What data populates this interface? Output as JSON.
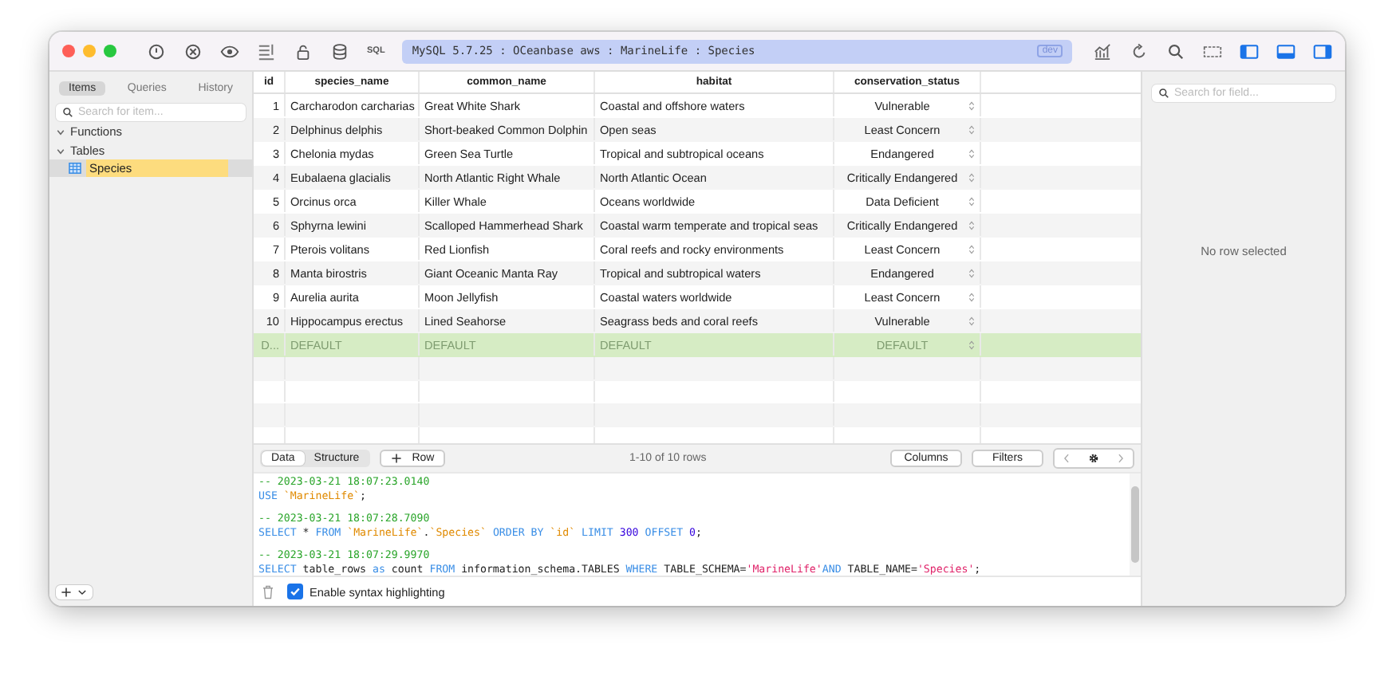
{
  "toolbar": {
    "sql_label": "SQL",
    "connection": "MySQL 5.7.25 : OCeanbase aws : MarineLife : Species",
    "badge": "dev",
    "panels": [
      {
        "kind": "left",
        "selected": true
      },
      {
        "kind": "bottom",
        "selected": true
      },
      {
        "kind": "right",
        "selected": true
      }
    ]
  },
  "sidebar": {
    "tabs": [
      {
        "label": "Items",
        "selected": true
      },
      {
        "label": "Queries",
        "selected": false
      },
      {
        "label": "History",
        "selected": false
      }
    ],
    "search": {
      "placeholder": "Search for item..."
    },
    "tree": [
      {
        "label": "Functions",
        "expanded": true
      },
      {
        "label": "Tables",
        "expanded": true,
        "children": [
          {
            "label": "Species",
            "selected": true
          }
        ]
      }
    ]
  },
  "table": {
    "columns": [
      "id",
      "species_name",
      "common_name",
      "habitat",
      "conservation_status"
    ],
    "rows": [
      [
        "1",
        "Carcharodon carcharias",
        "Great White Shark",
        "Coastal and offshore waters",
        "Vulnerable"
      ],
      [
        "2",
        "Delphinus delphis",
        "Short-beaked Common Dolphin",
        "Open seas",
        "Least Concern"
      ],
      [
        "3",
        "Chelonia mydas",
        "Green Sea Turtle",
        "Tropical and subtropical oceans",
        "Endangered"
      ],
      [
        "4",
        "Eubalaena glacialis",
        "North Atlantic Right Whale",
        "North Atlantic Ocean",
        "Critically Endangered"
      ],
      [
        "5",
        "Orcinus orca",
        "Killer Whale",
        "Oceans worldwide",
        "Data Deficient"
      ],
      [
        "6",
        "Sphyrna lewini",
        "Scalloped Hammerhead Shark",
        "Coastal warm temperate and tropical seas",
        "Critically Endangered"
      ],
      [
        "7",
        "Pterois volitans",
        "Red Lionfish",
        "Coral reefs and rocky environments",
        "Least Concern"
      ],
      [
        "8",
        "Manta birostris",
        "Giant Oceanic Manta Ray",
        "Tropical and subtropical waters",
        "Endangered"
      ],
      [
        "9",
        "Aurelia aurita",
        "Moon Jellyfish",
        "Coastal waters worldwide",
        "Least Concern"
      ],
      [
        "10",
        "Hippocampus erectus",
        "Lined Seahorse",
        "Seagrass beds and coral reefs",
        "Vulnerable"
      ]
    ],
    "new_row": [
      "D...",
      "DEFAULT",
      "DEFAULT",
      "DEFAULT",
      "DEFAULT"
    ]
  },
  "bottom_bar": {
    "view_tabs": [
      {
        "label": "Data",
        "selected": true
      },
      {
        "label": "Structure",
        "selected": false
      }
    ],
    "add_row": "Row",
    "row_count": "1-10 of 10 rows",
    "buttons": [
      "Columns",
      "Filters"
    ]
  },
  "console": {
    "entries": [
      {
        "comment": "-- 2023-03-21 18:07:23.0140",
        "tokens": [
          {
            "kind": "keyword",
            "text": "USE "
          },
          {
            "kind": "ident",
            "text": "`MarineLife`"
          },
          {
            "kind": "plain",
            "text": ";"
          }
        ]
      },
      {
        "comment": "-- 2023-03-21 18:07:28.7090",
        "tokens": [
          {
            "kind": "keyword",
            "text": "SELECT"
          },
          {
            "kind": "plain",
            "text": " * "
          },
          {
            "kind": "keyword",
            "text": "FROM "
          },
          {
            "kind": "ident",
            "text": "`MarineLife`"
          },
          {
            "kind": "plain",
            "text": "."
          },
          {
            "kind": "ident",
            "text": "`Species` "
          },
          {
            "kind": "keyword",
            "text": "ORDER BY "
          },
          {
            "kind": "ident",
            "text": "`id` "
          },
          {
            "kind": "keyword",
            "text": "LIMIT "
          },
          {
            "kind": "number",
            "text": "300 "
          },
          {
            "kind": "keyword",
            "text": "OFFSET "
          },
          {
            "kind": "number",
            "text": "0"
          },
          {
            "kind": "plain",
            "text": ";"
          }
        ]
      },
      {
        "comment": "-- 2023-03-21 18:07:29.9970",
        "tokens": [
          {
            "kind": "keyword",
            "text": "SELECT"
          },
          {
            "kind": "plain",
            "text": " table_rows "
          },
          {
            "kind": "keyword",
            "text": "as"
          },
          {
            "kind": "plain",
            "text": " count "
          },
          {
            "kind": "keyword",
            "text": "FROM"
          },
          {
            "kind": "plain",
            "text": " information_schema.TABLES "
          },
          {
            "kind": "keyword",
            "text": "WHERE"
          },
          {
            "kind": "plain",
            "text": " TABLE_SCHEMA="
          },
          {
            "kind": "string",
            "text": "'MarineLife'"
          },
          {
            "kind": "keyword",
            "text": "AND"
          },
          {
            "kind": "plain",
            "text": " TABLE_NAME="
          },
          {
            "kind": "string",
            "text": "'Species'"
          },
          {
            "kind": "plain",
            "text": ";"
          }
        ]
      }
    ]
  },
  "footer": {
    "syntax_highlighting": {
      "label": "Enable syntax highlighting",
      "checked": true
    }
  },
  "inspector": {
    "search": {
      "placeholder": "Search for field..."
    },
    "empty_message": "No row selected"
  }
}
